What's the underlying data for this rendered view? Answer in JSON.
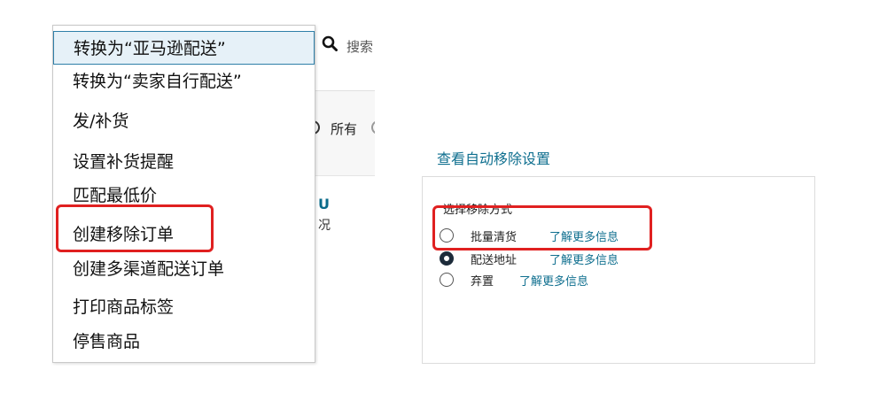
{
  "background": {
    "search_placeholder": "搜索",
    "filter_all_label": "所有",
    "card_letter": "U",
    "card_text": "况"
  },
  "menu": {
    "items": [
      {
        "label": "转换为“亚马逊配送”"
      },
      {
        "label": "转换为“卖家自行配送”"
      },
      {
        "label": "发/补货"
      },
      {
        "label": "设置补货提醒"
      },
      {
        "label": "匹配最低价"
      },
      {
        "label": "创建移除订单"
      },
      {
        "label": "创建多渠道配送订单"
      },
      {
        "label": "打印商品标签"
      },
      {
        "label": "停售商品"
      }
    ],
    "hovered_index": 0,
    "highlighted_index": 5
  },
  "removal_settings": {
    "view_link": "查看自动移除设置",
    "method_label": "选择移除方式",
    "options": [
      {
        "label": "批量清货",
        "link": "了解更多信息",
        "checked": false
      },
      {
        "label": "配送地址",
        "link": "了解更多信息",
        "checked": true
      },
      {
        "label": "弃置",
        "link": "了解更多信息",
        "checked": false
      }
    ]
  },
  "colors": {
    "highlight_red": "#e02020",
    "link_teal": "#0f6f8f",
    "hover_bg": "#e6f1f8"
  }
}
